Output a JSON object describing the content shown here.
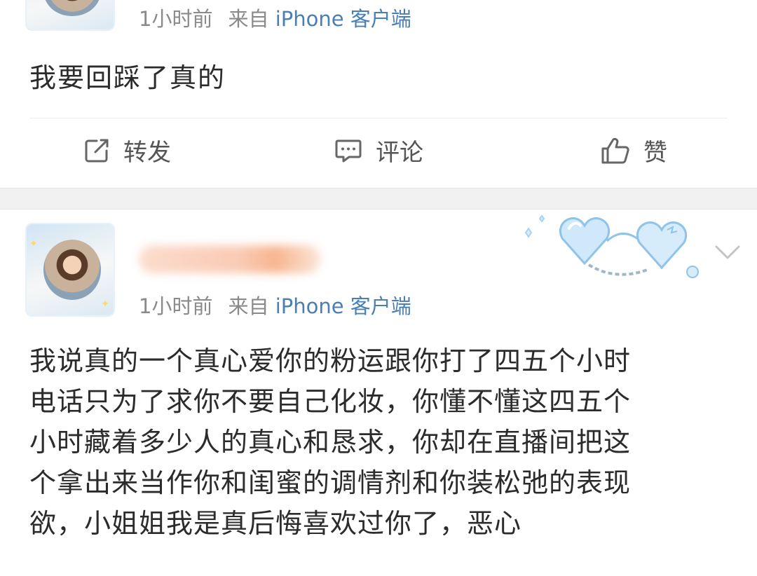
{
  "post1": {
    "time": "1小时前",
    "source_prefix": "来自",
    "source_app": "iPhone 客户端",
    "text": "我要回踩了真的",
    "actions": {
      "repost": "转发",
      "comment": "评论",
      "like": "赞"
    }
  },
  "post2": {
    "time": "1小时前",
    "source_prefix": "来自",
    "source_app": "iPhone 客户端",
    "lines": [
      "我说真的一个真心爱你的粉运跟你打了四五个小时",
      "电话只为了求你不要自己化妆，你懂不懂这四五个",
      "小时藏着多少人的真心和恳求，你却在直播间把这",
      "个拿出来当作你和闺蜜的调情剂和你装松弛的表现",
      "欲，小姐姐我是真后悔喜欢过你了，恶心"
    ]
  },
  "icons": {
    "repost": "repost-icon",
    "comment": "comment-icon",
    "like": "thumbs-up-icon",
    "more": "chevron-down-icon",
    "decor": "heart-handcuffs-decoration-icon"
  },
  "colors": {
    "background": "#f1f1f1",
    "card": "#ffffff",
    "meta_text": "#8a8a8a",
    "app_link": "#4a7fb4",
    "body_text": "#2b2b2b"
  }
}
